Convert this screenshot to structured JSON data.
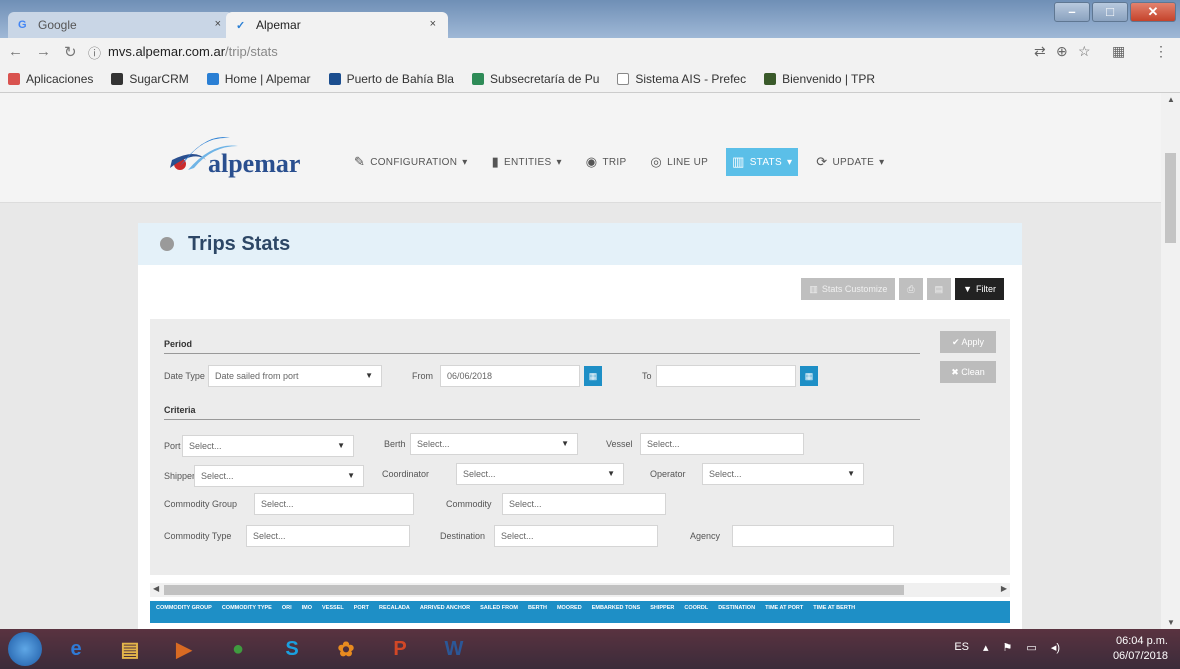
{
  "browser": {
    "tabs": [
      {
        "label": "Google"
      },
      {
        "label": "Alpemar"
      }
    ],
    "tab_close_glyph": "×",
    "url_host": "mvs.alpemar.com.ar",
    "url_path": "/trip/stats",
    "bookmarks": [
      {
        "label": "Aplicaciones",
        "color": "#d9534f"
      },
      {
        "label": "SugarCRM",
        "color": "#333333"
      },
      {
        "label": "Home | Alpemar",
        "color": "#2a7fd4"
      },
      {
        "label": "Puerto de Bahía Bla",
        "color": "#1b4e8f"
      },
      {
        "label": "Subsecretaría de Pu",
        "color": "#2e8b57"
      },
      {
        "label": "Sistema AIS - Prefec",
        "color": "#888888"
      },
      {
        "label": "Bienvenido | TPR",
        "color": "#3a5a2a"
      }
    ]
  },
  "app": {
    "logo_text": "alpemar",
    "nav": [
      {
        "label": "Configuration",
        "icon": "wrench-icon",
        "glyph": "✎",
        "dropdown": true
      },
      {
        "label": "Entities",
        "icon": "book-icon",
        "glyph": "▮",
        "dropdown": true
      },
      {
        "label": "Trip",
        "icon": "globe-icon",
        "glyph": "◉",
        "dropdown": false
      },
      {
        "label": "Line Up",
        "icon": "target-icon",
        "glyph": "◎",
        "dropdown": false
      },
      {
        "label": "Stats",
        "icon": "bar-chart-icon",
        "glyph": "▥",
        "dropdown": true,
        "active": true
      },
      {
        "label": "Update",
        "icon": "refresh-icon",
        "glyph": "⟳",
        "dropdown": true
      }
    ],
    "dropdown_caret": "▾"
  },
  "panel": {
    "title": "Trips Stats",
    "toolbar": {
      "stats_customize": "Stats Customize",
      "filter": "Filter"
    },
    "filters": {
      "period_label": "Period",
      "date_type_label": "Date Type",
      "date_type_value": "Date sailed from port",
      "from_label": "From",
      "from_value": "06/06/2018",
      "to_label": "To",
      "to_value": "",
      "criteria_label": "Criteria",
      "port_label": "Port",
      "berth_label": "Berth",
      "vessel_label": "Vessel",
      "shipper_label": "Shipper",
      "coordinator_label": "Coordinator",
      "operator_label": "Operator",
      "commodity_group_label": "Commodity Group",
      "commodity_label": "Commodity",
      "commodity_type_label": "Commodity Type",
      "destination_label": "Destination",
      "agency_label": "Agency",
      "select_placeholder": "Select...",
      "apply_label": "Apply",
      "clean_label": "Clean"
    },
    "table_headers": [
      "Commodity Group",
      "Commodity Type",
      "Ori",
      "IMO",
      "Vessel",
      "Port",
      "Recalada",
      "Arrived Anchor",
      "Sailed From",
      "Berth",
      "Moored",
      "Embarked Tons",
      "Shipper",
      "Coordl",
      "Destination",
      "Time at Port",
      "Time at Berth"
    ]
  },
  "taskbar": {
    "lang": "ES",
    "time": "06:04 p.m.",
    "date": "06/07/2018",
    "apps": [
      {
        "name": "ie-icon",
        "glyph": "e",
        "color": "#2f7ad6"
      },
      {
        "name": "explorer-icon",
        "glyph": "▤",
        "color": "#e3b54a"
      },
      {
        "name": "media-icon",
        "glyph": "▶",
        "color": "#d86a23"
      },
      {
        "name": "chrome-icon",
        "glyph": "●",
        "color": "#3f9b3f"
      },
      {
        "name": "skype-icon",
        "glyph": "S",
        "color": "#1aa0e0"
      },
      {
        "name": "app-icon",
        "glyph": "✿",
        "color": "#e88b1f"
      },
      {
        "name": "powerpoint-icon",
        "glyph": "P",
        "color": "#d24726"
      },
      {
        "name": "word-icon",
        "glyph": "W",
        "color": "#2b5797"
      }
    ]
  }
}
